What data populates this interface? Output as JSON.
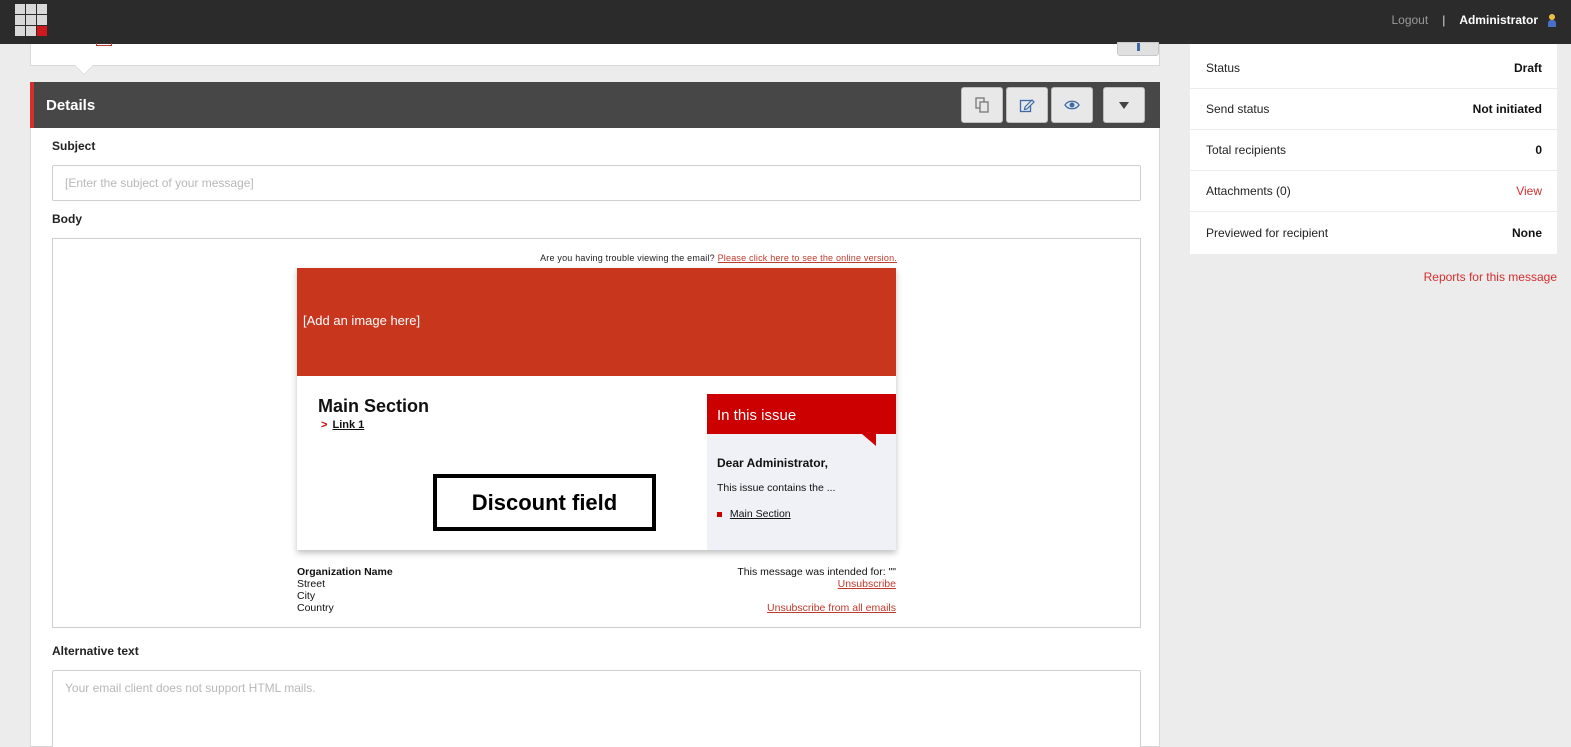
{
  "topbar": {
    "logout_label": "Logout",
    "separator": "|",
    "user_name": "Administrator",
    "app_menu_icon": "app-grid-icon",
    "user_icon": "user-icon"
  },
  "details": {
    "title": "Details",
    "buttons": {
      "copy_icon": "copy-icon",
      "edit_icon": "edit-icon",
      "preview_icon": "eye-icon",
      "more_icon": "caret-down-icon"
    },
    "subject": {
      "label": "Subject",
      "placeholder": "[Enter the subject of your message]",
      "value": ""
    },
    "body": {
      "label": "Body"
    },
    "alternative_text": {
      "label": "Alternative text",
      "placeholder": "Your email client does not support HTML mails.",
      "value": ""
    }
  },
  "email": {
    "trouble_text": "Are you having trouble viewing the email?",
    "online_version_link": "Please click here to see the online version.",
    "hero_placeholder": "[Add an image here]",
    "main_section_title": "Main Section",
    "link_marker": ">",
    "link1": "Link 1",
    "discount_field": "Discount field",
    "issue_title": "In this issue",
    "greeting": "Dear Administrator,",
    "contains_text": "This issue contains the ...",
    "issue_link": "Main Section",
    "footer": {
      "org_name": "Organization Name",
      "street": "Street",
      "city": "City",
      "country": "Country",
      "intended_for": "This message was intended for: \"\"",
      "unsubscribe": "Unsubscribe",
      "unsubscribe_all": "Unsubscribe from all emails"
    }
  },
  "properties": [
    {
      "label": "Status",
      "value": "Draft"
    },
    {
      "label": "Send status",
      "value": "Not initiated"
    },
    {
      "label": "Total recipients",
      "value": "0"
    },
    {
      "label": "Attachments (0)",
      "value": "View"
    },
    {
      "label": "Previewed for recipient",
      "value": "None"
    }
  ],
  "reports_link": "Reports for this message",
  "colors": {
    "accent_red": "#d32f2f",
    "topbar_bg": "#2b2b2b",
    "header_bg": "#474747",
    "hero_bg": "#c8361e"
  }
}
